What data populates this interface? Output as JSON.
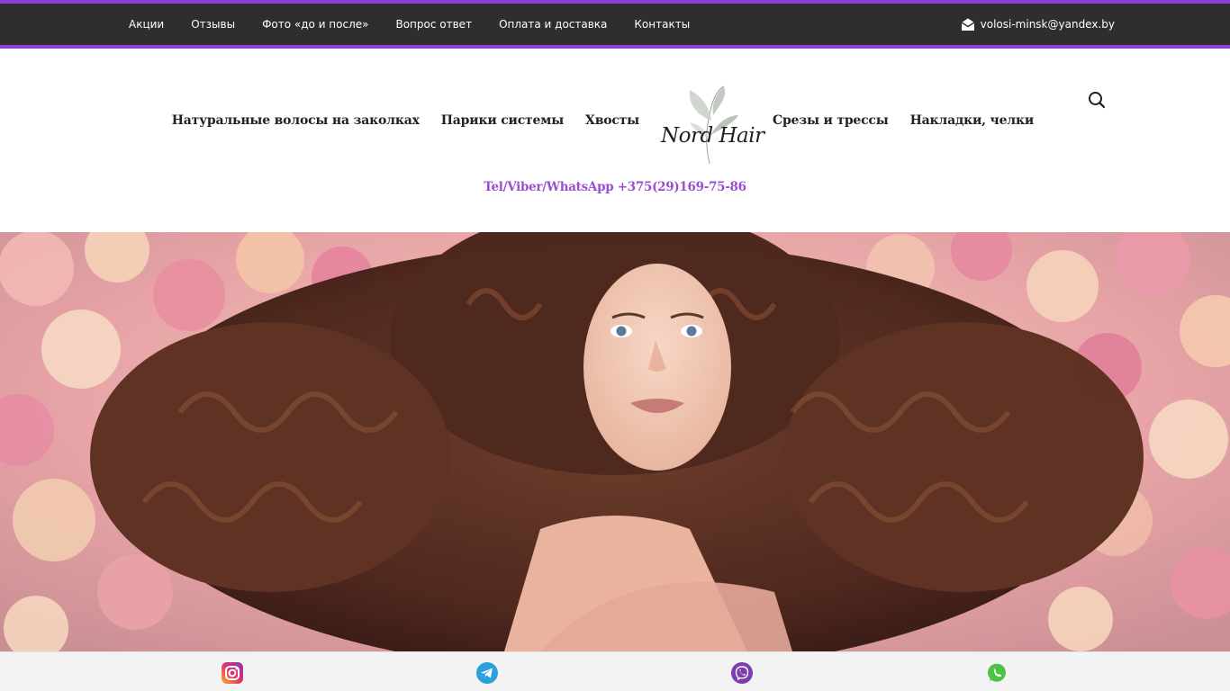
{
  "topbar": {
    "links": [
      "Акции",
      "Отзывы",
      "Фото «до и после»",
      "Вопрос ответ",
      "Оплата и доставка",
      "Контакты"
    ],
    "email": "volosi-minsk@yandex.by",
    "accent_color": "#8e3fd6",
    "background_color": "#2e2e2e",
    "email_icon": "envelope-open-icon"
  },
  "header": {
    "nav_left": [
      "Натуральные волосы на заколках",
      "Парики системы",
      "Хвосты"
    ],
    "nav_right": [
      "Срезы и трессы",
      "Накладки, челки"
    ],
    "logo_text": "Nord Hair",
    "search_icon": "search-icon",
    "phone": "Tel/Viber/WhatsApp +375(29)169-75-86",
    "phone_color": "#9a4fd0"
  },
  "hero": {
    "image": "woman-with-curly-hair-among-flowers"
  },
  "bottombar": {
    "icons": [
      "instagram-icon",
      "telegram-icon",
      "viber-icon",
      "whatsapp-icon"
    ]
  }
}
